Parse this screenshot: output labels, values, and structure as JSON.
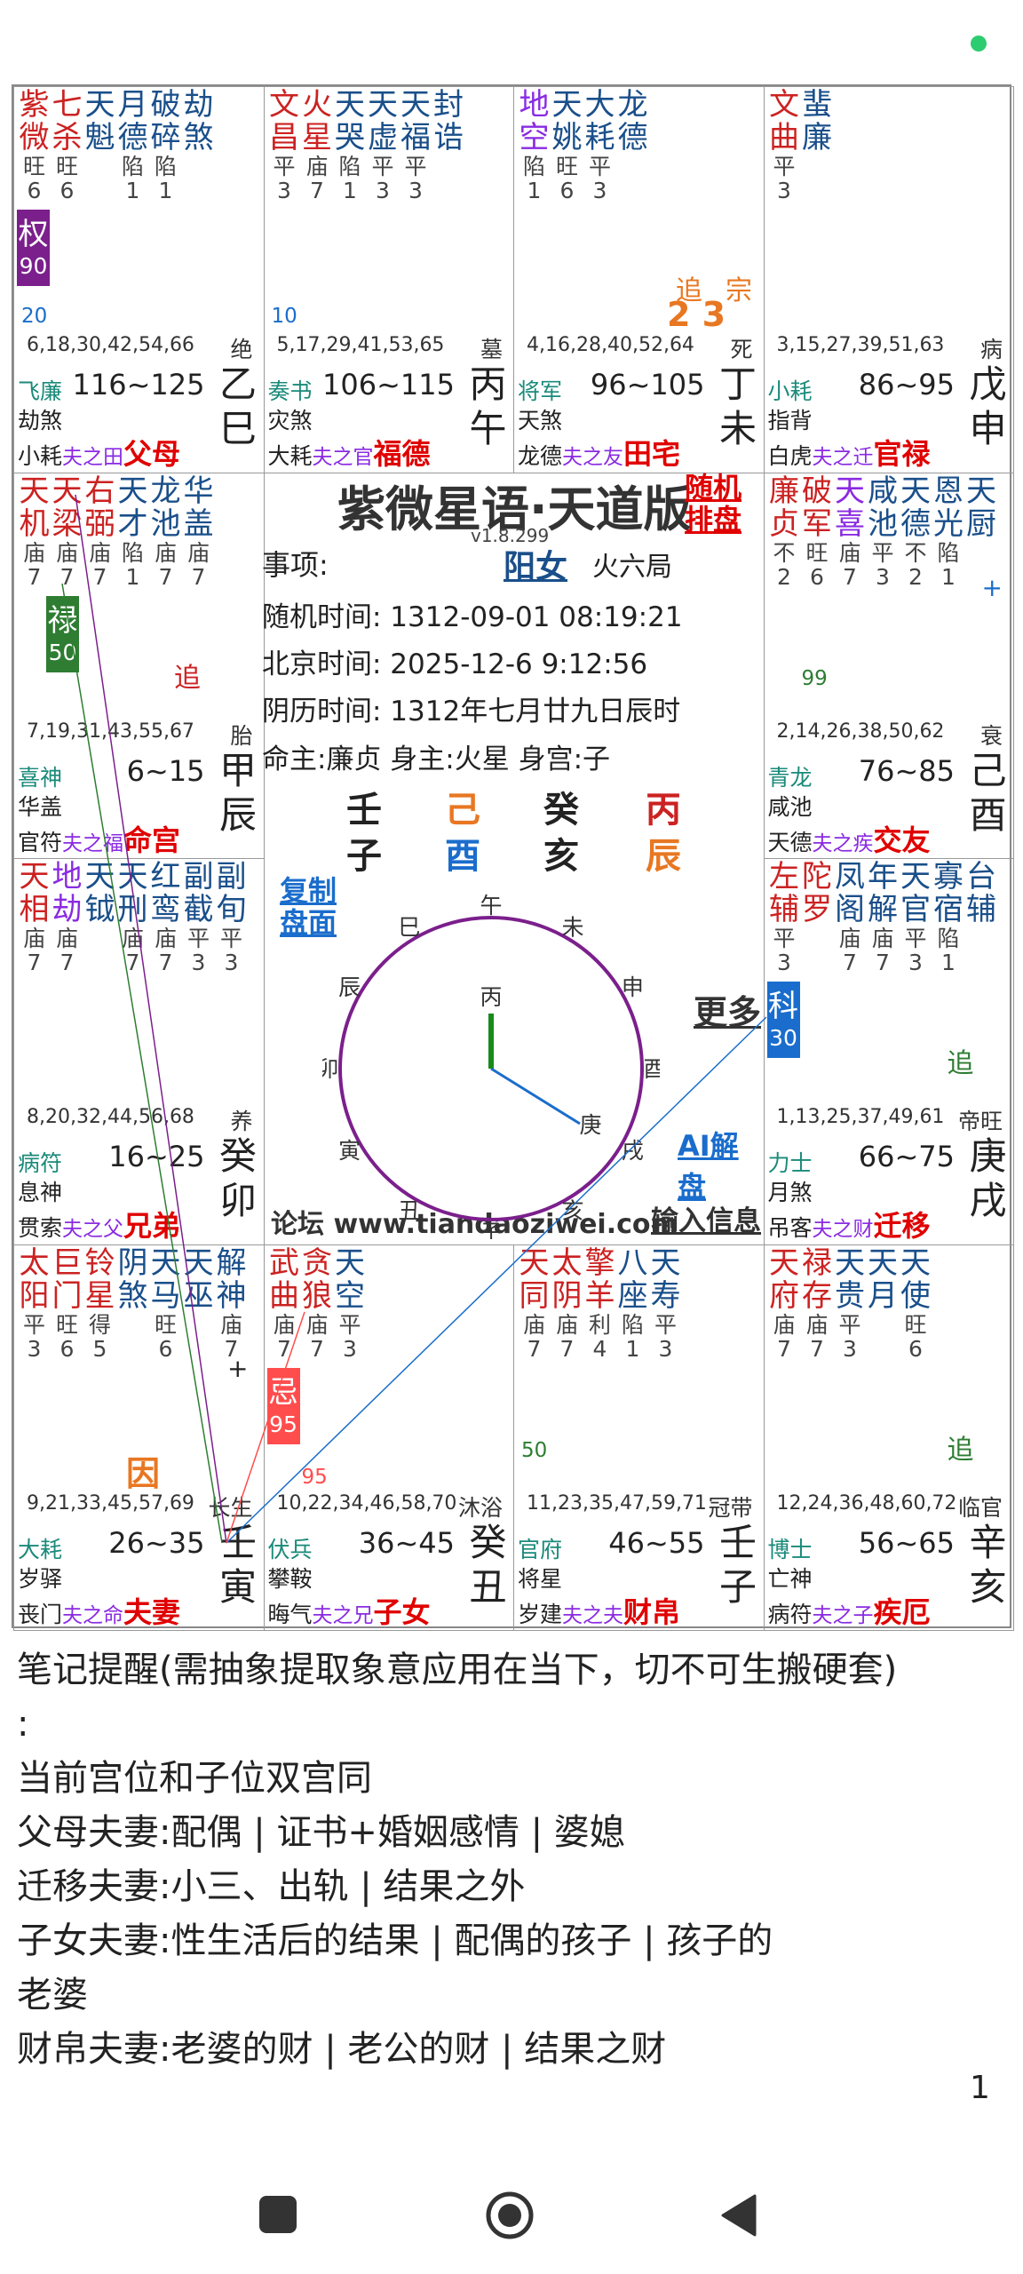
{
  "status_dot_color": "#2ecc71",
  "cells": [
    {
      "stars": [
        {
          "c": [
            "紫",
            "微"
          ],
          "col": "#cc2222"
        },
        {
          "c": [
            "七",
            "杀"
          ],
          "col": "#cc2222"
        },
        {
          "c": [
            "天",
            "魁"
          ],
          "col": "#1a4f8a"
        },
        {
          "c": [
            "月",
            "德"
          ],
          "col": "#1a4f8a"
        },
        {
          "c": [
            "破",
            "碎"
          ],
          "col": "#1a4f8a"
        },
        {
          "c": [
            "劫",
            "煞"
          ],
          "col": "#1a4f8a"
        }
      ],
      "bright": [
        "旺",
        "旺",
        "",
        "陷",
        "陷",
        ""
      ],
      "bnum": [
        "6",
        "6",
        "",
        "1",
        "1",
        ""
      ],
      "mark": {
        "t": "权",
        "v": "90",
        "bg": "#7b1f8c"
      },
      "small": "20",
      "small_col": "#1a6dcc",
      "ages": "6,18,30,42,54,66",
      "stage": "绝",
      "b1": "飞廉",
      "b2": "劫煞",
      "b3a": "小耗",
      "rel": "夫之田",
      "palace": "父母",
      "range": "116~125",
      "gan": "乙",
      "zhi": "巳"
    },
    {
      "stars": [
        {
          "c": [
            "文",
            "昌"
          ],
          "col": "#cc2222"
        },
        {
          "c": [
            "火",
            "星"
          ],
          "col": "#cc2222"
        },
        {
          "c": [
            "天",
            "哭"
          ],
          "col": "#1a4f8a"
        },
        {
          "c": [
            "天",
            "虚"
          ],
          "col": "#1a4f8a"
        },
        {
          "c": [
            "天",
            "福"
          ],
          "col": "#1a4f8a"
        },
        {
          "c": [
            "封",
            "诰"
          ],
          "col": "#1a4f8a"
        }
      ],
      "bright": [
        "平",
        "庙",
        "陷",
        "平",
        "平",
        ""
      ],
      "bnum": [
        "3",
        "7",
        "1",
        "3",
        "3",
        ""
      ],
      "small": "10",
      "small_col": "#1a6dcc",
      "ages": "5,17,29,41,53,65",
      "stage": "墓",
      "b1": "奏书",
      "b2": "灾煞",
      "b3a": "大耗",
      "rel": "夫之官",
      "palace": "福德",
      "range": "106~115",
      "gan": "丙",
      "zhi": "午"
    },
    {
      "stars": [
        {
          "c": [
            "地",
            "空"
          ],
          "col": "#8a2be2"
        },
        {
          "c": [
            "天",
            "姚"
          ],
          "col": "#1a4f8a"
        },
        {
          "c": [
            "大",
            "耗"
          ],
          "col": "#1a4f8a"
        },
        {
          "c": [
            "龙",
            "德"
          ],
          "col": "#1a4f8a"
        }
      ],
      "bright": [
        "陷",
        "旺",
        "平",
        ""
      ],
      "bnum": [
        "1",
        "6",
        "3",
        ""
      ],
      "zhui": "追",
      "zong": "宗",
      "zhui_num": "2 3",
      "ages": "4,16,28,40,52,64",
      "stage": "死",
      "b1": "将军",
      "b2": "天煞",
      "b3a": "龙德",
      "rel": "夫之友",
      "palace": "田宅",
      "range": "96~105",
      "gan": "丁",
      "zhi": "未"
    },
    {
      "stars": [
        {
          "c": [
            "文",
            "曲"
          ],
          "col": "#cc2222"
        },
        {
          "c": [
            "蜚",
            "廉"
          ],
          "col": "#1a4f8a"
        }
      ],
      "bright": [
        "平",
        ""
      ],
      "bnum": [
        "3",
        ""
      ],
      "ages": "3,15,27,39,51,63",
      "stage": "病",
      "b1": "小耗",
      "b2": "指背",
      "b3a": "白虎",
      "rel": "夫之迁",
      "palace": "官禄",
      "range": "86~95",
      "gan": "戊",
      "zhi": "申"
    },
    {
      "stars": [
        {
          "c": [
            "天",
            "机"
          ],
          "col": "#cc2222"
        },
        {
          "c": [
            "天",
            "梁"
          ],
          "col": "#cc2222"
        },
        {
          "c": [
            "右",
            "弼"
          ],
          "col": "#cc2222"
        },
        {
          "c": [
            "天",
            "才"
          ],
          "col": "#1a4f8a"
        },
        {
          "c": [
            "龙",
            "池"
          ],
          "col": "#1a4f8a"
        },
        {
          "c": [
            "华",
            "盖"
          ],
          "col": "#1a4f8a"
        }
      ],
      "bright": [
        "庙",
        "庙",
        "庙",
        "陷",
        "庙",
        "庙"
      ],
      "bnum": [
        "7",
        "7",
        "7",
        "1",
        "7",
        "7"
      ],
      "mark": {
        "t": "禄",
        "v": "50",
        "bg": "#2e7d32"
      },
      "zhui": "追",
      "ages": "7,19,31,43,55,67",
      "stage": "胎",
      "b1": "喜神",
      "b2": "华盖",
      "b3a": "官符",
      "rel": "夫之福",
      "palace": "命宫",
      "range": "6~15",
      "gan": "甲",
      "zhi": "辰"
    },
    {
      "stars": [
        {
          "c": [
            "廉",
            "贞"
          ],
          "col": "#cc2222"
        },
        {
          "c": [
            "破",
            "军"
          ],
          "col": "#cc2222"
        },
        {
          "c": [
            "天",
            "喜"
          ],
          "col": "#8a2be2"
        },
        {
          "c": [
            "咸",
            "池"
          ],
          "col": "#1a4f8a"
        },
        {
          "c": [
            "天",
            "德"
          ],
          "col": "#1a4f8a"
        },
        {
          "c": [
            "恩",
            "光"
          ],
          "col": "#1a4f8a"
        },
        {
          "c": [
            "天",
            "厨"
          ],
          "col": "#1a4f8a"
        }
      ],
      "bright": [
        "不",
        "旺",
        "庙",
        "平",
        "不",
        "陷",
        ""
      ],
      "bnum": [
        "2",
        "6",
        "7",
        "3",
        "2",
        "1",
        ""
      ],
      "small": "99",
      "small_col": "#2e7d32",
      "plus": "+",
      "ages": "2,14,26,38,50,62",
      "stage": "衰",
      "b1": "青龙",
      "b2": "咸池",
      "b3a": "天德",
      "rel": "夫之疾",
      "palace": "交友",
      "range": "76~85",
      "gan": "己",
      "zhi": "酉"
    },
    {
      "stars": [
        {
          "c": [
            "天",
            "相"
          ],
          "col": "#cc2222"
        },
        {
          "c": [
            "地",
            "劫"
          ],
          "col": "#8a2be2"
        },
        {
          "c": [
            "天",
            "钺"
          ],
          "col": "#1a4f8a"
        },
        {
          "c": [
            "天",
            "刑"
          ],
          "col": "#1a4f8a"
        },
        {
          "c": [
            "红",
            "鸾"
          ],
          "col": "#1a4f8a"
        },
        {
          "c": [
            "副",
            "截"
          ],
          "col": "#1a4f8a"
        },
        {
          "c": [
            "副",
            "旬"
          ],
          "col": "#1a4f8a"
        }
      ],
      "bright": [
        "庙",
        "庙",
        "",
        "庙",
        "庙",
        "平",
        "平"
      ],
      "bnum": [
        "7",
        "7",
        "",
        "7",
        "7",
        "3",
        "3"
      ],
      "ages": "8,20,32,44,56,68",
      "stage": "养",
      "b1": "病符",
      "b2": "息神",
      "b3a": "贯索",
      "rel": "夫之父",
      "palace": "兄弟",
      "range": "16~25",
      "gan": "癸",
      "zhi": "卯"
    },
    {
      "stars": [
        {
          "c": [
            "左",
            "辅"
          ],
          "col": "#cc2222"
        },
        {
          "c": [
            "陀",
            "罗"
          ],
          "col": "#cc2222"
        },
        {
          "c": [
            "凤",
            "阁"
          ],
          "col": "#1a4f8a"
        },
        {
          "c": [
            "年",
            "解"
          ],
          "col": "#1a4f8a"
        },
        {
          "c": [
            "天",
            "官"
          ],
          "col": "#1a4f8a"
        },
        {
          "c": [
            "寡",
            "宿"
          ],
          "col": "#1a4f8a"
        },
        {
          "c": [
            "台",
            "辅"
          ],
          "col": "#1a4f8a"
        }
      ],
      "bright": [
        "平",
        "",
        "庙",
        "庙",
        "平",
        "陷",
        ""
      ],
      "bnum": [
        "3",
        "",
        "7",
        "7",
        "3",
        "1",
        ""
      ],
      "mark": {
        "t": "科",
        "v": "30",
        "bg": "#1a6dcc"
      },
      "zhui": "追",
      "ages": "1,13,25,37,49,61",
      "stage": "帝旺",
      "b1": "力士",
      "b2": "月煞",
      "b3a": "吊客",
      "rel": "夫之财",
      "palace": "迁移",
      "range": "66~75",
      "gan": "庚",
      "zhi": "戌"
    },
    {
      "stars": [
        {
          "c": [
            "太",
            "阳"
          ],
          "col": "#cc2222"
        },
        {
          "c": [
            "巨",
            "门"
          ],
          "col": "#cc2222"
        },
        {
          "c": [
            "铃",
            "星"
          ],
          "col": "#cc2222"
        },
        {
          "c": [
            "阴",
            "煞"
          ],
          "col": "#1a4f8a"
        },
        {
          "c": [
            "天",
            "马"
          ],
          "col": "#1a4f8a"
        },
        {
          "c": [
            "天",
            "巫"
          ],
          "col": "#1a4f8a"
        },
        {
          "c": [
            "解",
            "神"
          ],
          "col": "#1a4f8a"
        }
      ],
      "bright": [
        "平",
        "旺",
        "得",
        "",
        "旺",
        "",
        "庙"
      ],
      "bnum": [
        "3",
        "6",
        "5",
        "",
        "6",
        "",
        "7"
      ],
      "yin": "因",
      "plus": "+",
      "ages": "9,21,33,45,57,69",
      "stage": "长生",
      "b1": "大耗",
      "b2": "岁驿",
      "b3a": "丧门",
      "rel": "夫之命",
      "palace": "夫妻",
      "range": "26~35",
      "gan": "壬",
      "zhi": "寅"
    },
    {
      "stars": [
        {
          "c": [
            "武",
            "曲"
          ],
          "col": "#cc2222"
        },
        {
          "c": [
            "贪",
            "狼"
          ],
          "col": "#cc2222"
        },
        {
          "c": [
            "天",
            "空"
          ],
          "col": "#1a4f8a"
        }
      ],
      "bright": [
        "庙",
        "庙",
        "平"
      ],
      "bnum": [
        "7",
        "7",
        "3"
      ],
      "mark": {
        "t": "忌",
        "v": "95",
        "bg": "#ff4d4d"
      },
      "small": "95",
      "small_col": "#ff4d4d",
      "ages": "10,22,34,46,58,70",
      "stage": "沐浴",
      "b1": "伏兵",
      "b2": "攀鞍",
      "b3a": "晦气",
      "rel": "夫之兄",
      "palace": "子女",
      "range": "36~45",
      "gan": "癸",
      "zhi": "丑"
    },
    {
      "stars": [
        {
          "c": [
            "天",
            "同"
          ],
          "col": "#cc2222"
        },
        {
          "c": [
            "太",
            "阴"
          ],
          "col": "#cc2222"
        },
        {
          "c": [
            "擎",
            "羊"
          ],
          "col": "#cc2222"
        },
        {
          "c": [
            "八",
            "座"
          ],
          "col": "#1a4f8a"
        },
        {
          "c": [
            "天",
            "寿"
          ],
          "col": "#1a4f8a"
        }
      ],
      "bright": [
        "庙",
        "庙",
        "利",
        "陷",
        "平"
      ],
      "bnum": [
        "7",
        "7",
        "4",
        "1",
        "3"
      ],
      "small": "50",
      "small_col": "#2e7d32",
      "ages": "11,23,35,47,59,71",
      "stage": "冠带",
      "b1": "官府",
      "b2": "将星",
      "b3a": "岁建",
      "rel": "夫之夫",
      "palace": "财帛",
      "range": "46~55",
      "gan": "壬",
      "zhi": "子"
    },
    {
      "stars": [
        {
          "c": [
            "天",
            "府"
          ],
          "col": "#cc2222"
        },
        {
          "c": [
            "禄",
            "存"
          ],
          "col": "#cc2222"
        },
        {
          "c": [
            "天",
            "贵"
          ],
          "col": "#1a4f8a"
        },
        {
          "c": [
            "天",
            "月"
          ],
          "col": "#1a4f8a"
        },
        {
          "c": [
            "天",
            "使"
          ],
          "col": "#1a4f8a"
        }
      ],
      "bright": [
        "庙",
        "庙",
        "平",
        "",
        "旺"
      ],
      "bnum": [
        "7",
        "7",
        "3",
        "",
        "6"
      ],
      "zhui": "追",
      "ages": "12,24,36,48,60,72",
      "stage": "临官",
      "b1": "博士",
      "b2": "亡神",
      "b3a": "病符",
      "rel": "夫之子",
      "palace": "疾厄",
      "range": "56~65",
      "gan": "辛",
      "zhi": "亥"
    }
  ],
  "center": {
    "title": "紫微星语·天道版",
    "version": "v1.8.299",
    "random_btn": [
      "随机",
      "排盘"
    ],
    "item_label": "事项:",
    "gender": "阳女",
    "bureau": "火六局",
    "lines": [
      "随机时间:  1312-09-01 08:19:21",
      "北京时间:  2025-12-6 9:12:56",
      "阴历时间:  1312年七月廿九日辰时",
      "命主:廉贞 身主:火星 身宫:子"
    ],
    "pillars_top": [
      {
        "t": "壬",
        "col": "#222"
      },
      {
        "t": "己",
        "col": "#e87722"
      },
      {
        "t": "癸",
        "col": "#222"
      },
      {
        "t": "丙",
        "col": "#cc2222"
      }
    ],
    "pillars_bot": [
      {
        "t": "子",
        "col": "#222"
      },
      {
        "t": "酉",
        "col": "#1a6dcc"
      },
      {
        "t": "亥",
        "col": "#222"
      },
      {
        "t": "辰",
        "col": "#e87722"
      }
    ],
    "copy_btn": [
      "复制",
      "盘面"
    ],
    "more_btn": "更多",
    "ai_btn": "AI解盘",
    "forum": "论坛 www.tiandaoziwei.com",
    "input_btn": "输入信息",
    "clock": [
      "午",
      "未",
      "申",
      "酉",
      "戌",
      "亥",
      "子",
      "丑",
      "寅",
      "卯",
      "辰",
      "巳"
    ],
    "clock_in1": "丙",
    "clock_in2": "庚"
  },
  "notes": [
    "笔记提醒(需抽象提取象意应用在当下，切不可生搬硬套)",
    ":",
    "当前宫位和子位双宫同",
    "父母夫妻:配偶 | 证书+婚姻感情 | 婆媳",
    "迁移夫妻:小三、出轨 | 结果之外",
    "子女夫妻:性生活后的结果 | 配偶的孩子 | 孩子的",
    "老婆",
    "财帛夫妻:老婆的财 | 老公的财 | 结果之财"
  ],
  "page_number": "1"
}
